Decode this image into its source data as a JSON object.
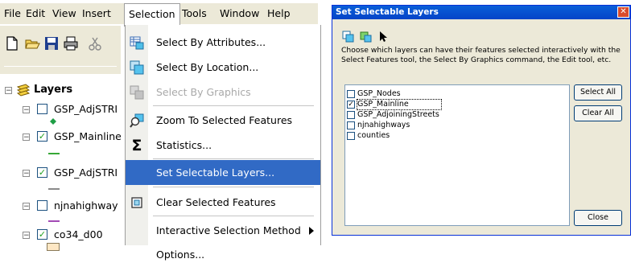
{
  "menubar": {
    "items": [
      "File",
      "Edit",
      "View",
      "Insert",
      "Selection",
      "Tools",
      "Window",
      "Help"
    ]
  },
  "toc": {
    "root": "Layers",
    "layers": [
      {
        "label": "GSP_AdjSTRI",
        "checked": false,
        "symbol_color": "#2ea043",
        "symbol": "point"
      },
      {
        "label": "GSP_Mainline",
        "checked": true,
        "symbol_color": "#37a837",
        "symbol": "line"
      },
      {
        "label": "GSP_AdjSTRI",
        "checked": true,
        "symbol_color": "#7a7a7a",
        "symbol": "line"
      },
      {
        "label": "njnahighway",
        "checked": false,
        "symbol_color": "#a24ab5",
        "symbol": "line"
      },
      {
        "label": "co34_d00",
        "checked": true,
        "symbol_color": "#fde7c4",
        "symbol": "fill"
      }
    ]
  },
  "selection_menu": {
    "items": [
      {
        "label": "Select By Attributes...",
        "icon": "select-by-attributes-icon",
        "disabled": false
      },
      {
        "label": "Select By Location...",
        "icon": "select-by-location-icon",
        "disabled": false
      },
      {
        "label": "Select By Graphics",
        "icon": "select-by-graphics-icon",
        "disabled": true
      },
      {
        "label": "Zoom To Selected Features",
        "icon": "zoom-to-selected-icon",
        "disabled": false
      },
      {
        "label": "Statistics...",
        "icon": "sigma-icon",
        "disabled": false
      },
      {
        "label": "Set Selectable Layers...",
        "icon": "",
        "disabled": false,
        "highlighted": true
      },
      {
        "label": "Clear Selected Features",
        "icon": "clear-selection-icon",
        "disabled": false
      },
      {
        "label": "Interactive Selection Method",
        "icon": "",
        "disabled": false,
        "submenu": true
      },
      {
        "label": "Options...",
        "icon": "",
        "disabled": false
      }
    ],
    "highlight_color": "#316ac5"
  },
  "dialog": {
    "title": "Set Selectable Layers",
    "description": "Choose which layers can have their features selected interactively with the Select Features tool, the Select By Graphics command, the Edit tool, etc.",
    "layers": [
      {
        "label": "GSP_Nodes",
        "checked": false
      },
      {
        "label": "GSP_Mainline",
        "checked": true
      },
      {
        "label": "GSP_AdjoiningStreets",
        "checked": false
      },
      {
        "label": "njnahighways",
        "checked": false
      },
      {
        "label": "counties",
        "checked": false
      }
    ],
    "buttons": {
      "select_all": "Select All",
      "clear_all": "Clear All",
      "close": "Close"
    },
    "title_color": "#0a5fd8"
  }
}
